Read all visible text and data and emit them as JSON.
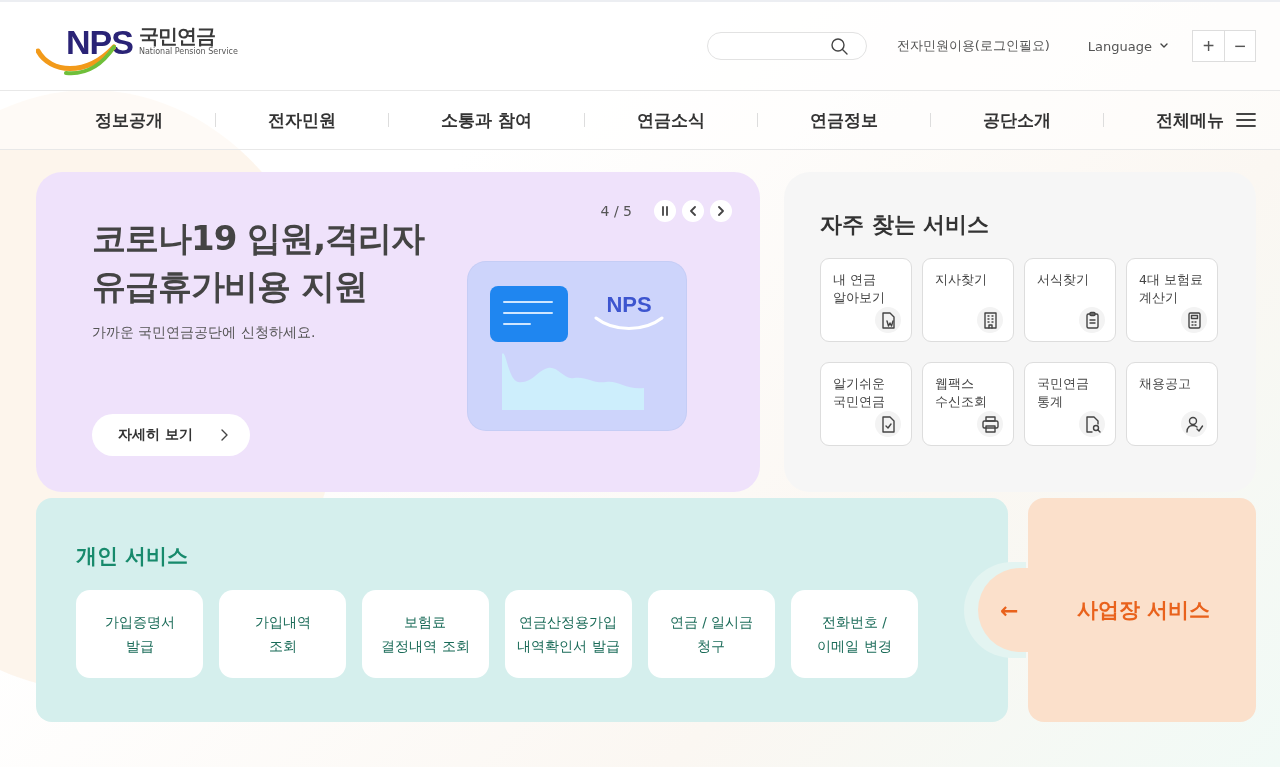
{
  "logo": {
    "mark": "NPS",
    "name": "국민연금",
    "subtitle": "National Pension Service"
  },
  "header": {
    "login_link": "전자민원이용(로그인필요)",
    "language": "Language",
    "font_buttons": [
      "+",
      "−"
    ]
  },
  "nav": {
    "items": [
      "정보공개",
      "전자민원",
      "소통과 참여",
      "연금소식",
      "연금정보",
      "공단소개"
    ],
    "all_menu": "전체메뉴"
  },
  "hero": {
    "title": "코로나19 입원,격리자\n유급휴가비용 지원",
    "subtitle": "가까운 국민연금공단에 신청하세요.",
    "counter": "4 / 5",
    "button": "자세히 보기",
    "illustration_mark": "NPS"
  },
  "quick_services": {
    "title": "자주 찾는 서비스",
    "items": [
      {
        "label": "내 연금\n알아보기"
      },
      {
        "label": "지사찾기"
      },
      {
        "label": "서식찾기"
      },
      {
        "label": "4대 보험료\n계산기"
      },
      {
        "label": "알기쉬운\n국민연금"
      },
      {
        "label": "웹팩스\n수신조회"
      },
      {
        "label": "국민연금\n통계"
      },
      {
        "label": "채용공고"
      }
    ]
  },
  "personal_services": {
    "title": "개인 서비스",
    "items": [
      "가입증명서\n발급",
      "가입내역\n조회",
      "보험료\n결정내역 조회",
      "연금산정용가입\n내역확인서 발급",
      "연금 / 일시금\n청구",
      "전화번호 /\n이메일 변경"
    ]
  },
  "business_services": {
    "arrow": "←",
    "label": "사업장 서비스"
  }
}
